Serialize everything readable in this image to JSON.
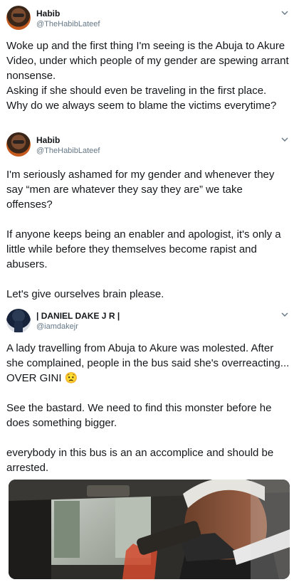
{
  "tweets": [
    {
      "name": "Habib",
      "handle": "@TheHabibLateef",
      "text": "Woke up and the first thing I'm seeing is the Abuja to Akure Video, under which people of my gender are spewing arrant nonsense.\nAsking if she should even be traveling in the first place.\nWhy do we always seem to blame the victims everytime?"
    },
    {
      "name": "Habib",
      "handle": "@TheHabibLateef",
      "text": "I'm seriously ashamed for my gender and whenever they say “men are whatever they say they are” we take offenses?\n\nIf anyone keeps being an enabler and apologist, it's only a little while before they themselves become rapist and abusers.\n\nLet's give ourselves brain please."
    },
    {
      "name": "| DANIEL DAKE J R |",
      "handle": "@iamdakejr",
      "text": "A lady travelling from Abuja to Akure was molested. After she complained, people in the bus said she's overreacting... OVER GINI 😟\n\nSee the bastard. We need to find this monster before he does something bigger.\n\neverybody in this bus is an an accomplice and should be arrested."
    }
  ],
  "icons": {
    "caret": "chevron-down-icon",
    "avatar_1": "profile-photo",
    "avatar_2": "profile-photo",
    "avatar_3": "profile-photo"
  },
  "colors": {
    "text": "#14171a",
    "secondary": "#657786",
    "divider": "#d6dbe0"
  }
}
